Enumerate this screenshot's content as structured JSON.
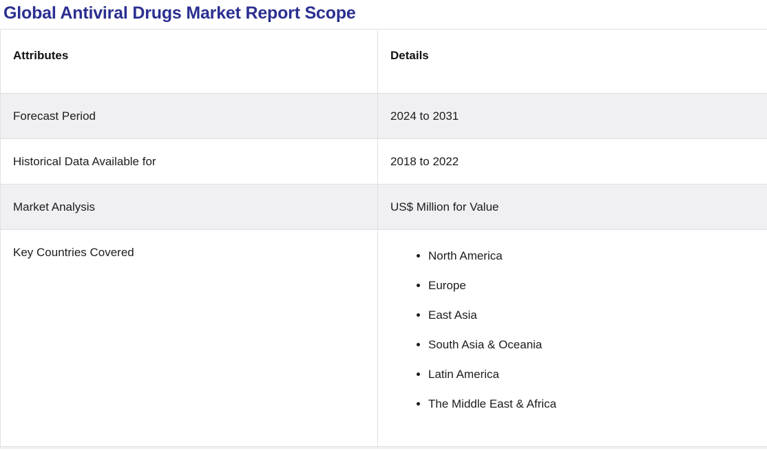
{
  "page": {
    "title": "Global Antiviral Drugs Market Report Scope"
  },
  "table": {
    "columns": [
      "Attributes",
      "Details"
    ],
    "rows": [
      {
        "attribute": "Forecast Period",
        "detail": "2024 to 2031"
      },
      {
        "attribute": "Historical Data Available for",
        "detail": "2018 to 2022"
      },
      {
        "attribute": "Market Analysis",
        "detail": "US$ Million for Value"
      },
      {
        "attribute": "Key Countries Covered",
        "details": [
          "North America",
          "Europe",
          "East Asia",
          "South Asia & Oceania",
          "Latin America",
          "The Middle East & Africa"
        ]
      }
    ]
  },
  "colors": {
    "title": "#2b2f90",
    "alt_row_background": "#f0f0f2",
    "border": "#e0e0e4",
    "text": "#1c1c1c"
  }
}
